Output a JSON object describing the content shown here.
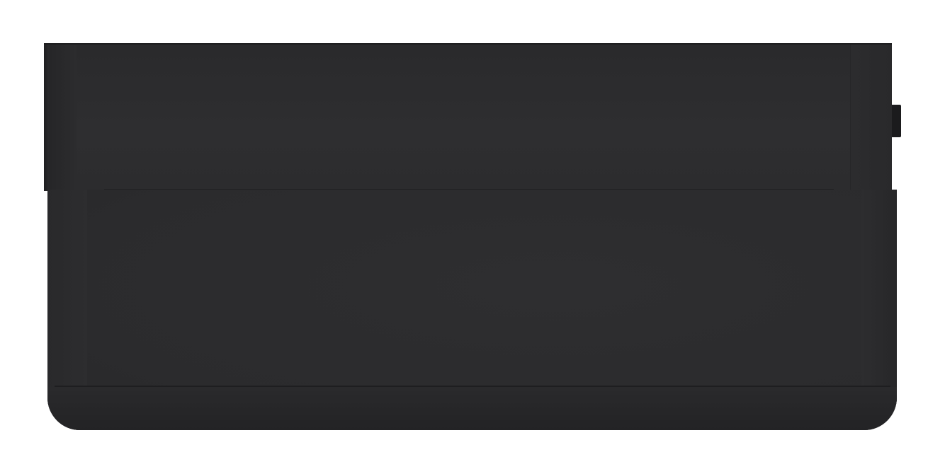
{
  "device": {
    "description_colors": {
      "body": "#2c2c2e",
      "edge": "#1c1c1e",
      "background": "#ffffff"
    },
    "parts": {
      "top_panel_icon": "device-top-panel",
      "body_icon": "device-body",
      "button_icon": "side-button"
    }
  }
}
